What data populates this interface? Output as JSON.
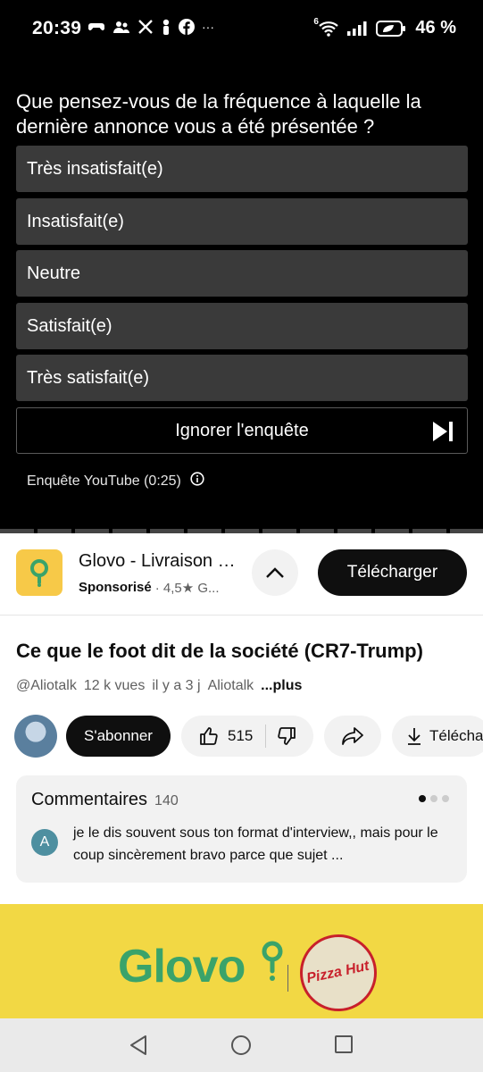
{
  "status": {
    "time": "20:39",
    "battery": "46 %",
    "net_badge": "6",
    "left_icons": [
      "game-controller-icon",
      "group-icon",
      "x-logo-icon",
      "figure-icon",
      "facebook-icon",
      "more-dots-icon"
    ],
    "right_icons": [
      "wifi-icon",
      "signal-icon",
      "battery-icon"
    ]
  },
  "survey": {
    "question": "Que pensez-vous de la fréquence à laquelle la dernière annonce vous a été présentée ?",
    "options": [
      "Très insatisfait(e)",
      "Insatisfait(e)",
      "Neutre",
      "Satisfait(e)",
      "Très satisfait(e)"
    ],
    "skip_label": "Ignorer l'enquête",
    "footer": "Enquête YouTube (0:25)"
  },
  "ad": {
    "title": "Glovo - Livraison de repas",
    "sponsored": "Sponsorisé",
    "rating": "· 4,5★ G...",
    "cta": "Télécharger"
  },
  "video": {
    "title": "Ce que le foot dit de la société (CR7-Trump)",
    "channel": "@Aliotalk",
    "views": "12 k vues",
    "age": "il y a 3 j",
    "channel_name": "Aliotalk",
    "more": "...plus"
  },
  "actions": {
    "subscribe": "S'abonner",
    "likes": "515",
    "download": "Téléchar"
  },
  "comments": {
    "title": "Commentaires",
    "count": "140",
    "first_initial": "A",
    "first_text": "je le dis souvent sous ton format d'interview,, mais pour le coup sincèrement bravo parce que sujet ..."
  },
  "banner": {
    "brand": "Glovo",
    "partner": "Pizza Hut",
    "colors": {
      "background": "#f2d844",
      "glovo_green": "#3aa36a",
      "pizzahut_red": "#c8202b"
    }
  },
  "theme": {
    "survey_bg": "#000000",
    "option_bg": "#3a3a3a",
    "pill_bg": "#f2f2f2"
  }
}
